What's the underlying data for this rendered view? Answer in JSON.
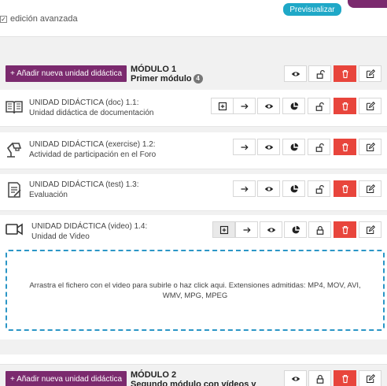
{
  "top": {
    "advanced_edit_label": "edición avanzada",
    "preview_label": "Previsualizar"
  },
  "modules": [
    {
      "add_unit_label": "+ Añadir nueva unidad didáctica",
      "title_line1": "MÓDULO 1",
      "title_line2": "Primer módulo",
      "unit_count": "4",
      "units": [
        {
          "type": "doc",
          "title": "UNIDAD DIDÁCTICA (doc) 1.1:",
          "subtitle": "Unidad didáctica de documentación"
        },
        {
          "type": "exercise",
          "title": "UNIDAD DIDÁCTICA (exercise) 1.2:",
          "subtitle": "Actividad de participación en el Foro"
        },
        {
          "type": "test",
          "title": "UNIDAD DIDÁCTICA (test) 1.3:",
          "subtitle": "Evaluación"
        },
        {
          "type": "video",
          "title": "UNIDAD DIDÁCTICA (video) 1.4:",
          "subtitle": "Unidad de Video"
        }
      ],
      "dropzone_text": "Arrastra el fichero con el video para subirle o haz click aqui. Extensiones admitidas: MP4, MOV, AVI, WMV, MPG, MPEG"
    },
    {
      "add_unit_label": "+ Añadir nueva unidad didáctica",
      "title_line1": "MÓDULO 2",
      "title_line2": "Segundo módulo con vídeos y"
    }
  ],
  "colors": {
    "accent": "#7b2a6e",
    "preview": "#1fa8c7",
    "delete": "#e8453c",
    "dropzone_border": "#2b96c6"
  },
  "icons": [
    "add-box-icon",
    "arrow-right-icon",
    "eye-icon",
    "pie-chart-icon",
    "lock-open-icon",
    "lock-closed-icon",
    "trash-icon",
    "edit-icon",
    "book-icon",
    "lamp-icon",
    "test-icon",
    "video-camera-icon"
  ]
}
